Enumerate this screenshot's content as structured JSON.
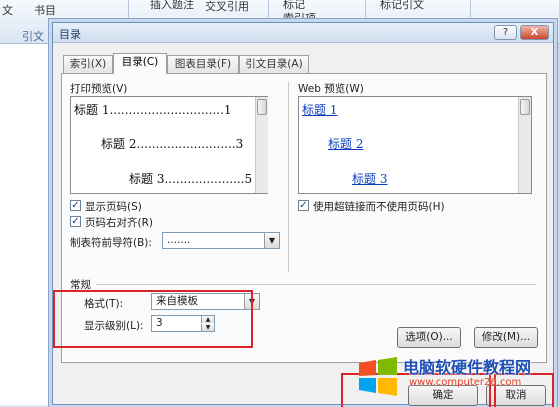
{
  "ribbon": {
    "items": [
      "文",
      "书目",
      "插入题注",
      "交叉引用",
      "标记",
      "索引项",
      "标记引文",
      "引文"
    ]
  },
  "dialog": {
    "title": "目录",
    "help_label": "?",
    "close_label": "X"
  },
  "tabs": [
    {
      "label": "索引(X)",
      "active": false
    },
    {
      "label": "目录(C)",
      "active": true
    },
    {
      "label": "图表目录(F)",
      "active": false
    },
    {
      "label": "引文目录(A)",
      "active": false
    }
  ],
  "print_preview": {
    "label": "打印预览(V)",
    "lines": [
      "标题 1..............................1",
      "标题 2..........................3",
      "标题 3.....................5"
    ]
  },
  "web_preview": {
    "label": "Web 预览(W)",
    "links": [
      "标题 1",
      "标题 2",
      "标题 3"
    ]
  },
  "options": {
    "show_page_numbers": {
      "label": "显示页码(S)",
      "checked": true
    },
    "right_align": {
      "label": "页码右对齐(R)",
      "checked": true
    },
    "use_hyperlinks": {
      "label": "使用超链接而不使用页码(H)",
      "checked": true
    },
    "tab_leader": {
      "label": "制表符前导符(B):",
      "value": "......."
    }
  },
  "general": {
    "heading": "常规",
    "format_label": "格式(T):",
    "format_value": "来自模板",
    "levels_label": "显示级别(L):",
    "levels_value": "3"
  },
  "buttons": {
    "options_label": "选项(O)...",
    "modify_label": "修改(M)...",
    "ok_label": "确定",
    "cancel_label": "取消"
  },
  "watermark": {
    "title": "电脑软硬件教程网",
    "url": "www.computer26.com"
  },
  "colors": {
    "highlight_red": "#d9242a",
    "link_blue": "#0b3fc0"
  }
}
